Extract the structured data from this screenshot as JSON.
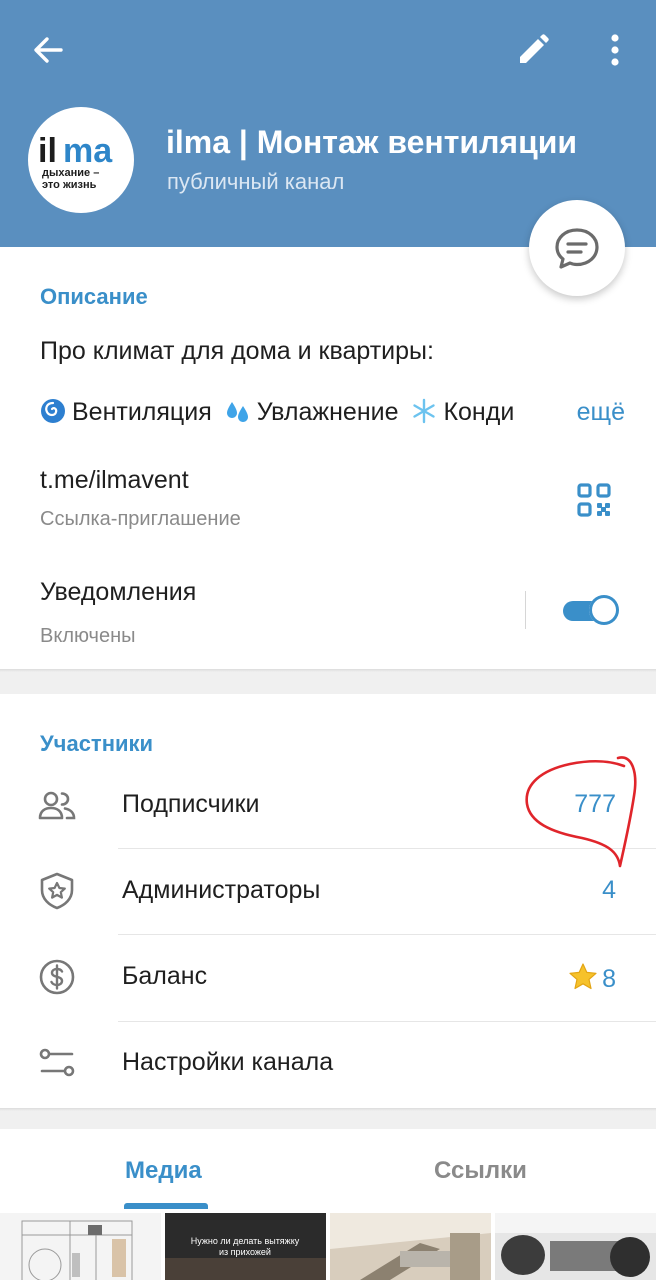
{
  "header": {
    "channel_name": "ilma | Монтаж вентиляции",
    "channel_type": "публичный канал",
    "avatar": {
      "logo_text": "ilma",
      "tagline_1": "дыхание –",
      "tagline_2": "это жизнь"
    },
    "icons": {
      "back": "arrow-left-icon",
      "edit": "pencil-icon",
      "more": "more-vert-icon"
    }
  },
  "description": {
    "title": "Описание",
    "line1": "Про климат для дома и квартиры:",
    "items": [
      "Вентиляция",
      "Увлажнение",
      "Конди"
    ],
    "more_label": "ещё"
  },
  "link": {
    "value": "t.me/ilmavent",
    "caption": "Ссылка-приглашение"
  },
  "notifications": {
    "label": "Уведомления",
    "status": "Включены",
    "enabled": true
  },
  "members": {
    "title": "Участники",
    "rows": [
      {
        "label": "Подписчики",
        "value": "777",
        "icon": "people-icon"
      },
      {
        "label": "Администраторы",
        "value": "4",
        "icon": "shield-star-icon"
      },
      {
        "label": "Баланс",
        "value": "8",
        "icon": "dollar-circle-icon"
      },
      {
        "label": "Настройки канала",
        "value": "",
        "icon": "sliders-icon"
      }
    ]
  },
  "tabs": [
    {
      "label": "Медиа",
      "active": true
    },
    {
      "label": "Ссылки",
      "active": false
    }
  ],
  "media": {
    "thumb2_caption_1": "Нужно ли делать вытяжку",
    "thumb2_caption_2": "из прихожей"
  },
  "colors": {
    "header": "#5a8fbf",
    "accent": "#3a8fc9",
    "annotation": "#e0252b"
  }
}
